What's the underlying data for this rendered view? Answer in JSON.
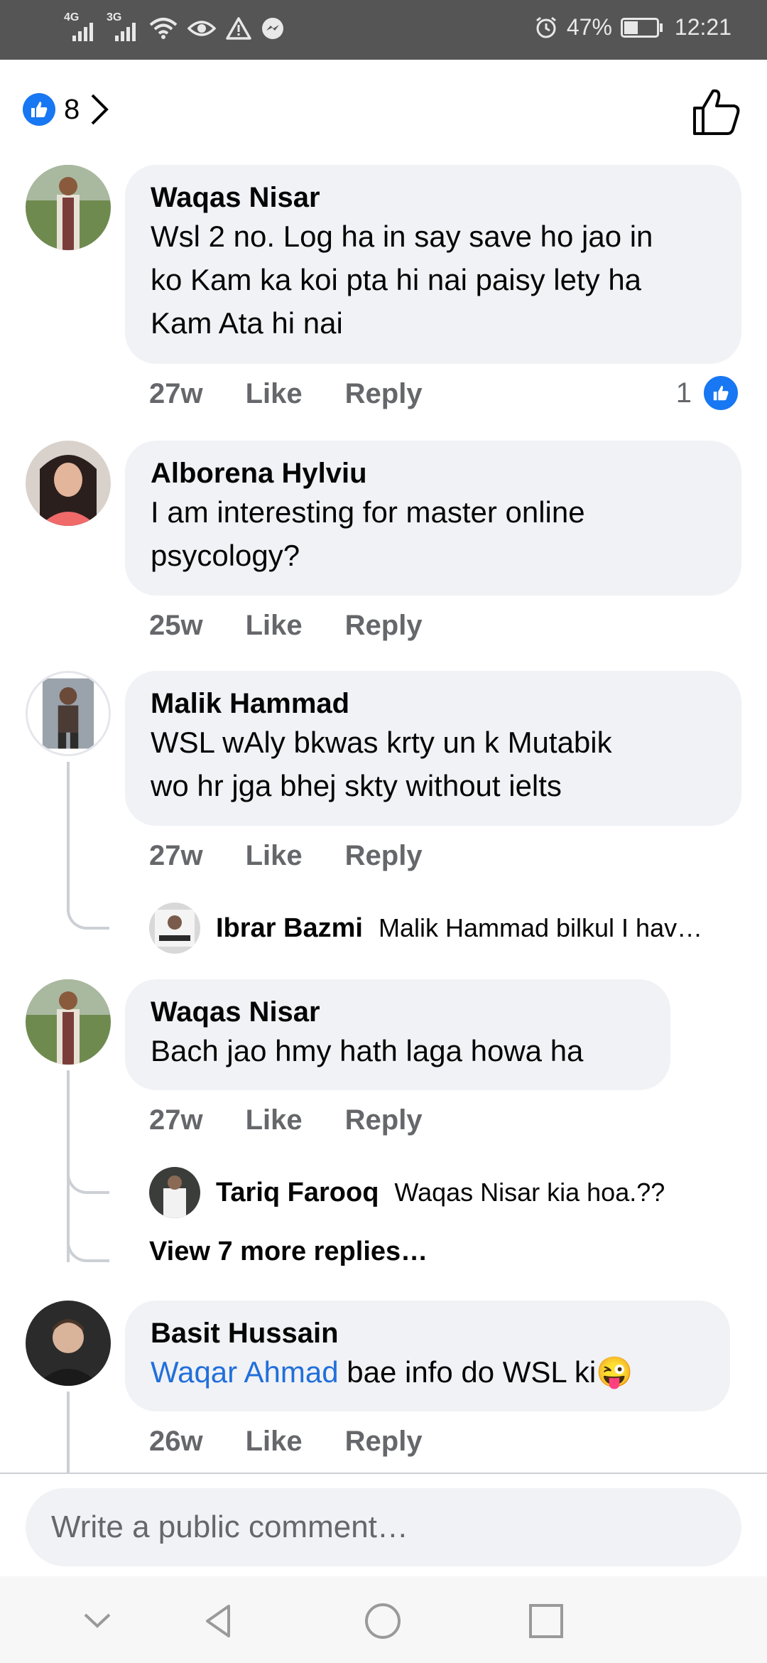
{
  "status_bar": {
    "network_1": "4G",
    "network_2": "3G",
    "battery": "47%",
    "battery_level": 0.47,
    "time": "12:21"
  },
  "header": {
    "reaction_count": "8"
  },
  "comments": [
    {
      "author": "Waqas Nisar",
      "lines": [
        "Wsl 2 no. Log ha in say save ho jao in",
        "ko Kam ka koi pta hi nai paisy lety ha",
        "Kam Ata hi nai"
      ],
      "time": "27w",
      "like": "Like",
      "reply": "Reply",
      "reactions": "1"
    },
    {
      "author": "Alborena Hylviu",
      "lines": [
        "I am interesting for master online",
        "psycology?"
      ],
      "time": "25w",
      "like": "Like",
      "reply": "Reply"
    },
    {
      "author": "Malik Hammad",
      "lines": [
        "WSL wAly bkwas krty un k Mutabik",
        "wo hr jga bhej skty without ielts"
      ],
      "time": "27w",
      "like": "Like",
      "reply": "Reply",
      "reply_preview": {
        "name": "Ibrar Bazmi",
        "text": "Malik Hammad bilkul  I hav…"
      }
    },
    {
      "author": "Waqas Nisar",
      "lines": [
        "Bach jao hmy hath laga howa ha"
      ],
      "time": "27w",
      "like": "Like",
      "reply": "Reply",
      "reply_preview": {
        "name": "Tariq Farooq",
        "text": "Waqas Nisar kia hoa.??"
      },
      "view_more": "View 7 more replies…"
    },
    {
      "author": "Basit Hussain",
      "mention": "Waqar Ahmad",
      "text_after_mention": " bae info do WSL ki",
      "emoji": "😜",
      "time": "26w",
      "like": "Like",
      "reply": "Reply"
    }
  ],
  "composer": {
    "placeholder": "Write a public comment…"
  },
  "colors": {
    "accent": "#1877f2",
    "bubble": "#f0f2f5",
    "secondary_text": "#65676b",
    "mention": "#216fdb",
    "status_bar": "#555555"
  }
}
